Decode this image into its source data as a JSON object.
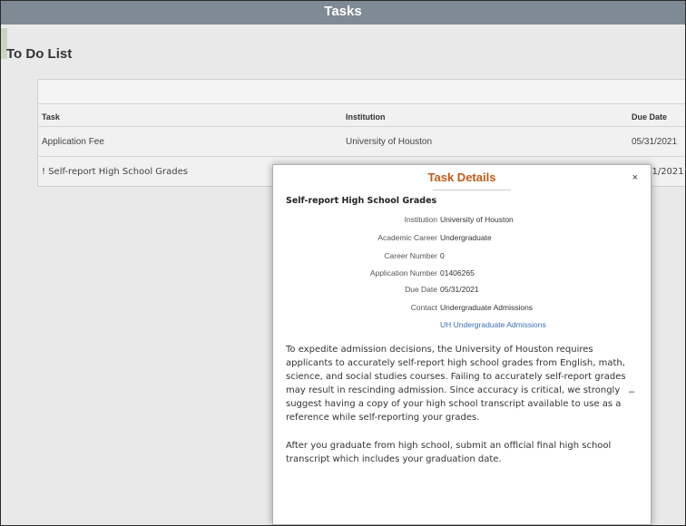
{
  "header": {
    "title": "Tasks"
  },
  "page": {
    "title": "To Do List"
  },
  "table": {
    "columns": {
      "task": "Task",
      "institution": "Institution",
      "due_date": "Due Date"
    },
    "rows": [
      {
        "task": "Application Fee",
        "institution": "University of Houston",
        "due_date": "05/31/2021"
      },
      {
        "task": "! Self-report High School Grades",
        "institution": "",
        "due_date": "05/31/2021"
      }
    ]
  },
  "modal": {
    "title": "Task Details",
    "close": "×",
    "heading": "Self-report High School Grades",
    "fields": {
      "institution": {
        "label": "Institution",
        "value": "University of Houston"
      },
      "academic_career": {
        "label": "Academic Career",
        "value": "Undergraduate"
      },
      "career_number": {
        "label": "Career Number",
        "value": "0"
      },
      "application_number": {
        "label": "Application Number",
        "value": "01406265"
      },
      "due_date": {
        "label": "Due Date",
        "value": "05/31/2021"
      },
      "contact": {
        "label": "Contact",
        "value": "Undergraduate Admissions"
      }
    },
    "link": "UH Undergraduate Admissions",
    "paragraph1": "To expedite admission decisions, the University of Houston requires applicants to accurately self-report high school grades from English, math, science, and social studies courses. Failing to accurately self-report grades may result in rescinding admission.  Since accuracy is critical, we strongly suggest having a copy of your high school transcript available to use as a reference while self-reporting your grades.",
    "paragraph2": "After you graduate from high school, submit an official final high school transcript which includes your graduation date.",
    "collapse": "–"
  }
}
